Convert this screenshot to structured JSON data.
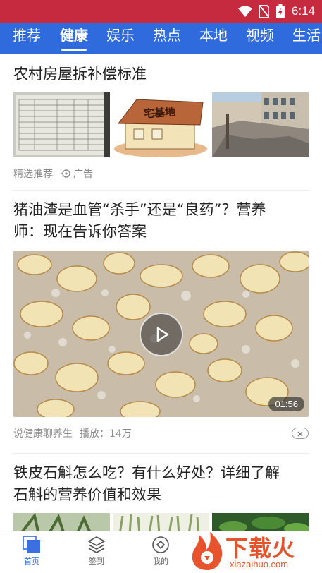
{
  "status_bar": {
    "time": "6:14",
    "bg_color": "#c62a3f"
  },
  "tabs": [
    {
      "label": "推荐",
      "active": false
    },
    {
      "label": "健康",
      "active": true
    },
    {
      "label": "娱乐",
      "active": false
    },
    {
      "label": "热点",
      "active": false
    },
    {
      "label": "本地",
      "active": false
    },
    {
      "label": "视频",
      "active": false
    },
    {
      "label": "生活",
      "active": false
    }
  ],
  "tab_bar_color": "#2f6bdc",
  "articles": [
    {
      "title": "农村房屋拆补偿标准",
      "thumb_sign": "宅基地",
      "meta_source": "精选推荐",
      "meta_ad": "广告"
    },
    {
      "title_line1": "猪油渣是血管“杀手”还是“良药”？营养",
      "title_line2": "师：现在告诉你答案",
      "duration": "01:56",
      "meta_source": "说健康聊养生",
      "meta_plays": "播放：14万"
    },
    {
      "title_line1": "铁皮石斛怎么吃？有什么好处？详细了解",
      "title_line2": "石斛的营养价值和效果"
    }
  ],
  "bottom_nav": [
    {
      "label": "首页",
      "icon": "home-icon",
      "active": true
    },
    {
      "label": "签到",
      "icon": "layers-icon",
      "active": false
    },
    {
      "label": "我的",
      "icon": "profile-icon",
      "active": false
    }
  ],
  "watermark": {
    "text": "下载火",
    "url": "xiazaihuo.com"
  }
}
